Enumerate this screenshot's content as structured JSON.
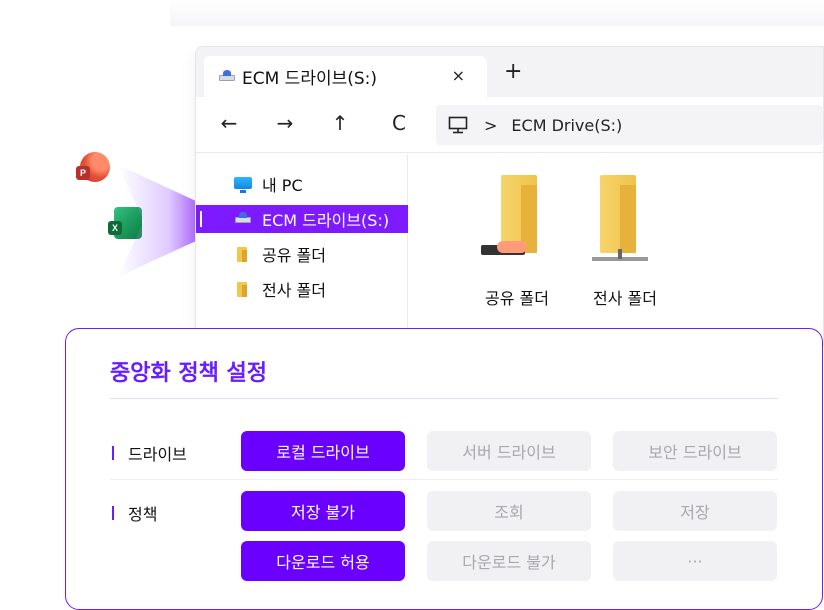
{
  "explorer": {
    "tab_title": "ECM 드라이브(S:)",
    "tab_close": "×",
    "new_tab": "+",
    "nav": {
      "back": "←",
      "forward": "→",
      "up": "↑",
      "refresh": "C"
    },
    "address": {
      "separator": ">",
      "path": "ECM Drive(S:)"
    },
    "sidebar": [
      {
        "label": "내 PC",
        "icon": "computer-icon"
      },
      {
        "label": "ECM 드라이브(S:)",
        "icon": "network-drive-icon",
        "active": true
      },
      {
        "label": "공유 폴더",
        "icon": "folder-icon"
      },
      {
        "label": "전사 폴더",
        "icon": "folder-icon"
      }
    ],
    "folders": [
      {
        "label": "공유 폴더",
        "icon": "shared-folder-icon"
      },
      {
        "label": "전사 폴더",
        "icon": "network-folder-icon"
      }
    ]
  },
  "apps": [
    {
      "name": "powerpoint-icon",
      "badge": "P"
    },
    {
      "name": "excel-icon",
      "badge": "X"
    }
  ],
  "policy": {
    "title": "중앙화 정책 설정",
    "rows": [
      {
        "label": "드라이브",
        "options": [
          {
            "label": "로컬 드라이브",
            "selected": true
          },
          {
            "label": "서버 드라이브",
            "selected": false
          },
          {
            "label": "보안 드라이브",
            "selected": false
          }
        ]
      },
      {
        "label": "정책",
        "options": [
          {
            "label": "저장 불가",
            "selected": true
          },
          {
            "label": "조회",
            "selected": false
          },
          {
            "label": "저장",
            "selected": false
          },
          {
            "label": "다운로드 허용",
            "selected": true
          },
          {
            "label": "다운로드 불가",
            "selected": false
          },
          {
            "label": "···",
            "selected": false
          }
        ]
      }
    ]
  },
  "colors": {
    "accent": "#6a00ff",
    "selected_bg": "#7d1aff",
    "chip_off": "#f1f1f3"
  }
}
